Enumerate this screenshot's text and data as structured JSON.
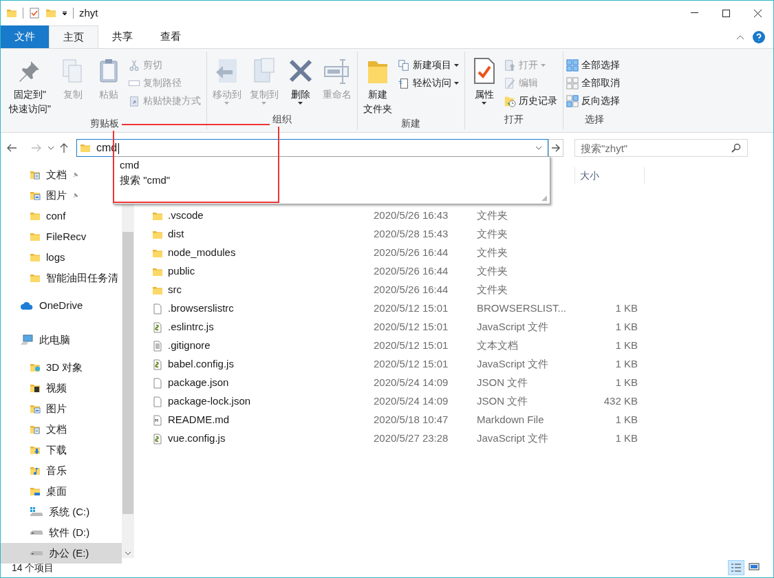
{
  "window": {
    "title": "zhyt"
  },
  "file_menu": {
    "label": "文件"
  },
  "ribbon_tabs": [
    {
      "label": "主页",
      "selected": true
    },
    {
      "label": "共享",
      "selected": false
    },
    {
      "label": "查看",
      "selected": false
    }
  ],
  "ribbon_groups": [
    {
      "label": "剪贴板",
      "large": [
        {
          "lines": [
            "固定到\"",
            "快速访问\""
          ],
          "kind": "pin",
          "disabled": false,
          "dropdown": false
        },
        {
          "lines": [
            "复制"
          ],
          "kind": "copy",
          "disabled": true,
          "dropdown": false
        },
        {
          "lines": [
            "粘贴"
          ],
          "kind": "paste",
          "disabled": true,
          "dropdown": false
        }
      ],
      "small": [
        {
          "label": "剪切",
          "kind": "cut",
          "disabled": true,
          "dropdown": false
        },
        {
          "label": "复制路径",
          "kind": "path",
          "disabled": true,
          "dropdown": false
        },
        {
          "label": "粘贴快捷方式",
          "kind": "shortcut",
          "disabled": true,
          "dropdown": false
        }
      ]
    },
    {
      "label": "组织",
      "large": [
        {
          "lines": [
            "移动到"
          ],
          "kind": "move",
          "disabled": true,
          "dropdown": true
        },
        {
          "lines": [
            "复制到"
          ],
          "kind": "copyto",
          "disabled": true,
          "dropdown": true
        },
        {
          "lines": [
            "删除"
          ],
          "kind": "delete",
          "disabled": false,
          "dropdown": true
        },
        {
          "lines": [
            "重命名"
          ],
          "kind": "rename",
          "disabled": true,
          "dropdown": false
        }
      ]
    },
    {
      "label": "新建",
      "large": [
        {
          "lines": [
            "新建",
            "文件夹"
          ],
          "kind": "folder",
          "disabled": false,
          "dropdown": false
        }
      ],
      "small": [
        {
          "label": "新建项目",
          "kind": "newitem",
          "disabled": false,
          "dropdown": true
        },
        {
          "label": "轻松访问",
          "kind": "easy",
          "disabled": false,
          "dropdown": true
        }
      ]
    },
    {
      "label": "打开",
      "large": [
        {
          "lines": [
            "属性"
          ],
          "kind": "props",
          "disabled": false,
          "dropdown": true
        }
      ],
      "small": [
        {
          "label": "打开",
          "kind": "open",
          "disabled": true,
          "dropdown": true
        },
        {
          "label": "编辑",
          "kind": "edit",
          "disabled": true,
          "dropdown": false
        },
        {
          "label": "历史记录",
          "kind": "history",
          "disabled": false,
          "dropdown": false
        }
      ]
    },
    {
      "label": "选择",
      "small": [
        {
          "label": "全部选择",
          "kind": "selall",
          "disabled": false,
          "dropdown": false
        },
        {
          "label": "全部取消",
          "kind": "selnone",
          "disabled": false,
          "dropdown": false
        },
        {
          "label": "反向选择",
          "kind": "selinv",
          "disabled": false,
          "dropdown": false
        }
      ]
    }
  ],
  "address": {
    "value": "cmd",
    "suggestions": [
      "cmd",
      "搜索 \"cmd\""
    ]
  },
  "search": {
    "placeholder": "搜索\"zhyt\""
  },
  "nav": [
    {
      "label": "文档",
      "kind": "docs",
      "pinned": true,
      "selected": false
    },
    {
      "label": "图片",
      "kind": "pics",
      "pinned": true,
      "selected": false
    },
    {
      "label": "conf",
      "kind": "folder",
      "pinned": false,
      "selected": false
    },
    {
      "label": "FileRecv",
      "kind": "folder",
      "pinned": false,
      "selected": false
    },
    {
      "label": "logs",
      "kind": "folder",
      "pinned": false,
      "selected": false
    },
    {
      "label": "智能油田任务清",
      "kind": "folder",
      "pinned": false,
      "selected": false
    },
    {
      "label": "OneDrive",
      "kind": "cloud",
      "pinned": false,
      "selected": false
    },
    {
      "label": "此电脑",
      "kind": "pc",
      "pinned": false,
      "selected": false
    },
    {
      "label": "3D 对象",
      "kind": "cube",
      "pinned": false,
      "selected": false
    },
    {
      "label": "视频",
      "kind": "video",
      "pinned": false,
      "selected": false
    },
    {
      "label": "图片",
      "kind": "pics",
      "pinned": false,
      "selected": false
    },
    {
      "label": "文档",
      "kind": "docs",
      "pinned": false,
      "selected": false
    },
    {
      "label": "下载",
      "kind": "download",
      "pinned": false,
      "selected": false
    },
    {
      "label": "音乐",
      "kind": "music",
      "pinned": false,
      "selected": false
    },
    {
      "label": "桌面",
      "kind": "desktop",
      "pinned": false,
      "selected": false
    },
    {
      "label": "系统 (C:)",
      "kind": "sysdrive",
      "pinned": false,
      "selected": false
    },
    {
      "label": "软件 (D:)",
      "kind": "drive",
      "pinned": false,
      "selected": false
    },
    {
      "label": "办公 (E:)",
      "kind": "drive",
      "pinned": false,
      "selected": true
    }
  ],
  "columns": [
    {
      "label": "大小"
    }
  ],
  "files": [
    {
      "name": ".vscode",
      "date": "2020/5/26 16:43",
      "type": "文件夹",
      "kind": "folder"
    },
    {
      "name": "dist",
      "date": "2020/5/28 15:43",
      "type": "文件夹",
      "kind": "folder"
    },
    {
      "name": "node_modules",
      "date": "2020/5/26 16:44",
      "type": "文件夹",
      "kind": "folder"
    },
    {
      "name": "public",
      "date": "2020/5/26 16:44",
      "type": "文件夹",
      "kind": "folder"
    },
    {
      "name": "src",
      "date": "2020/5/26 16:44",
      "type": "文件夹",
      "kind": "folder"
    },
    {
      "name": ".browserslistrc",
      "date": "2020/5/12 15:01",
      "type": "BROWSERSLIST...",
      "size": "1 KB",
      "kind": "file"
    },
    {
      "name": ".eslintrc.js",
      "date": "2020/5/12 15:01",
      "type": "JavaScript 文件",
      "size": "1 KB",
      "kind": "js"
    },
    {
      "name": ".gitignore",
      "date": "2020/5/12 15:01",
      "type": "文本文档",
      "size": "1 KB",
      "kind": "text"
    },
    {
      "name": "babel.config.js",
      "date": "2020/5/12 15:01",
      "type": "JavaScript 文件",
      "size": "1 KB",
      "kind": "js"
    },
    {
      "name": "package.json",
      "date": "2020/5/24 14:09",
      "type": "JSON 文件",
      "size": "1 KB",
      "kind": "file"
    },
    {
      "name": "package-lock.json",
      "date": "2020/5/24 14:09",
      "type": "JSON 文件",
      "size": "432 KB",
      "kind": "file"
    },
    {
      "name": "README.md",
      "date": "2020/5/18 10:47",
      "type": "Markdown File",
      "size": "1 KB",
      "kind": "md"
    },
    {
      "name": "vue.config.js",
      "date": "2020/5/27 23:28",
      "type": "JavaScript 文件",
      "size": "1 KB",
      "kind": "js"
    }
  ],
  "status_bar": {
    "count": "14 个项目"
  },
  "view_buttons": [
    {
      "kind": "details",
      "selected": true
    },
    {
      "kind": "large",
      "selected": false
    }
  ]
}
